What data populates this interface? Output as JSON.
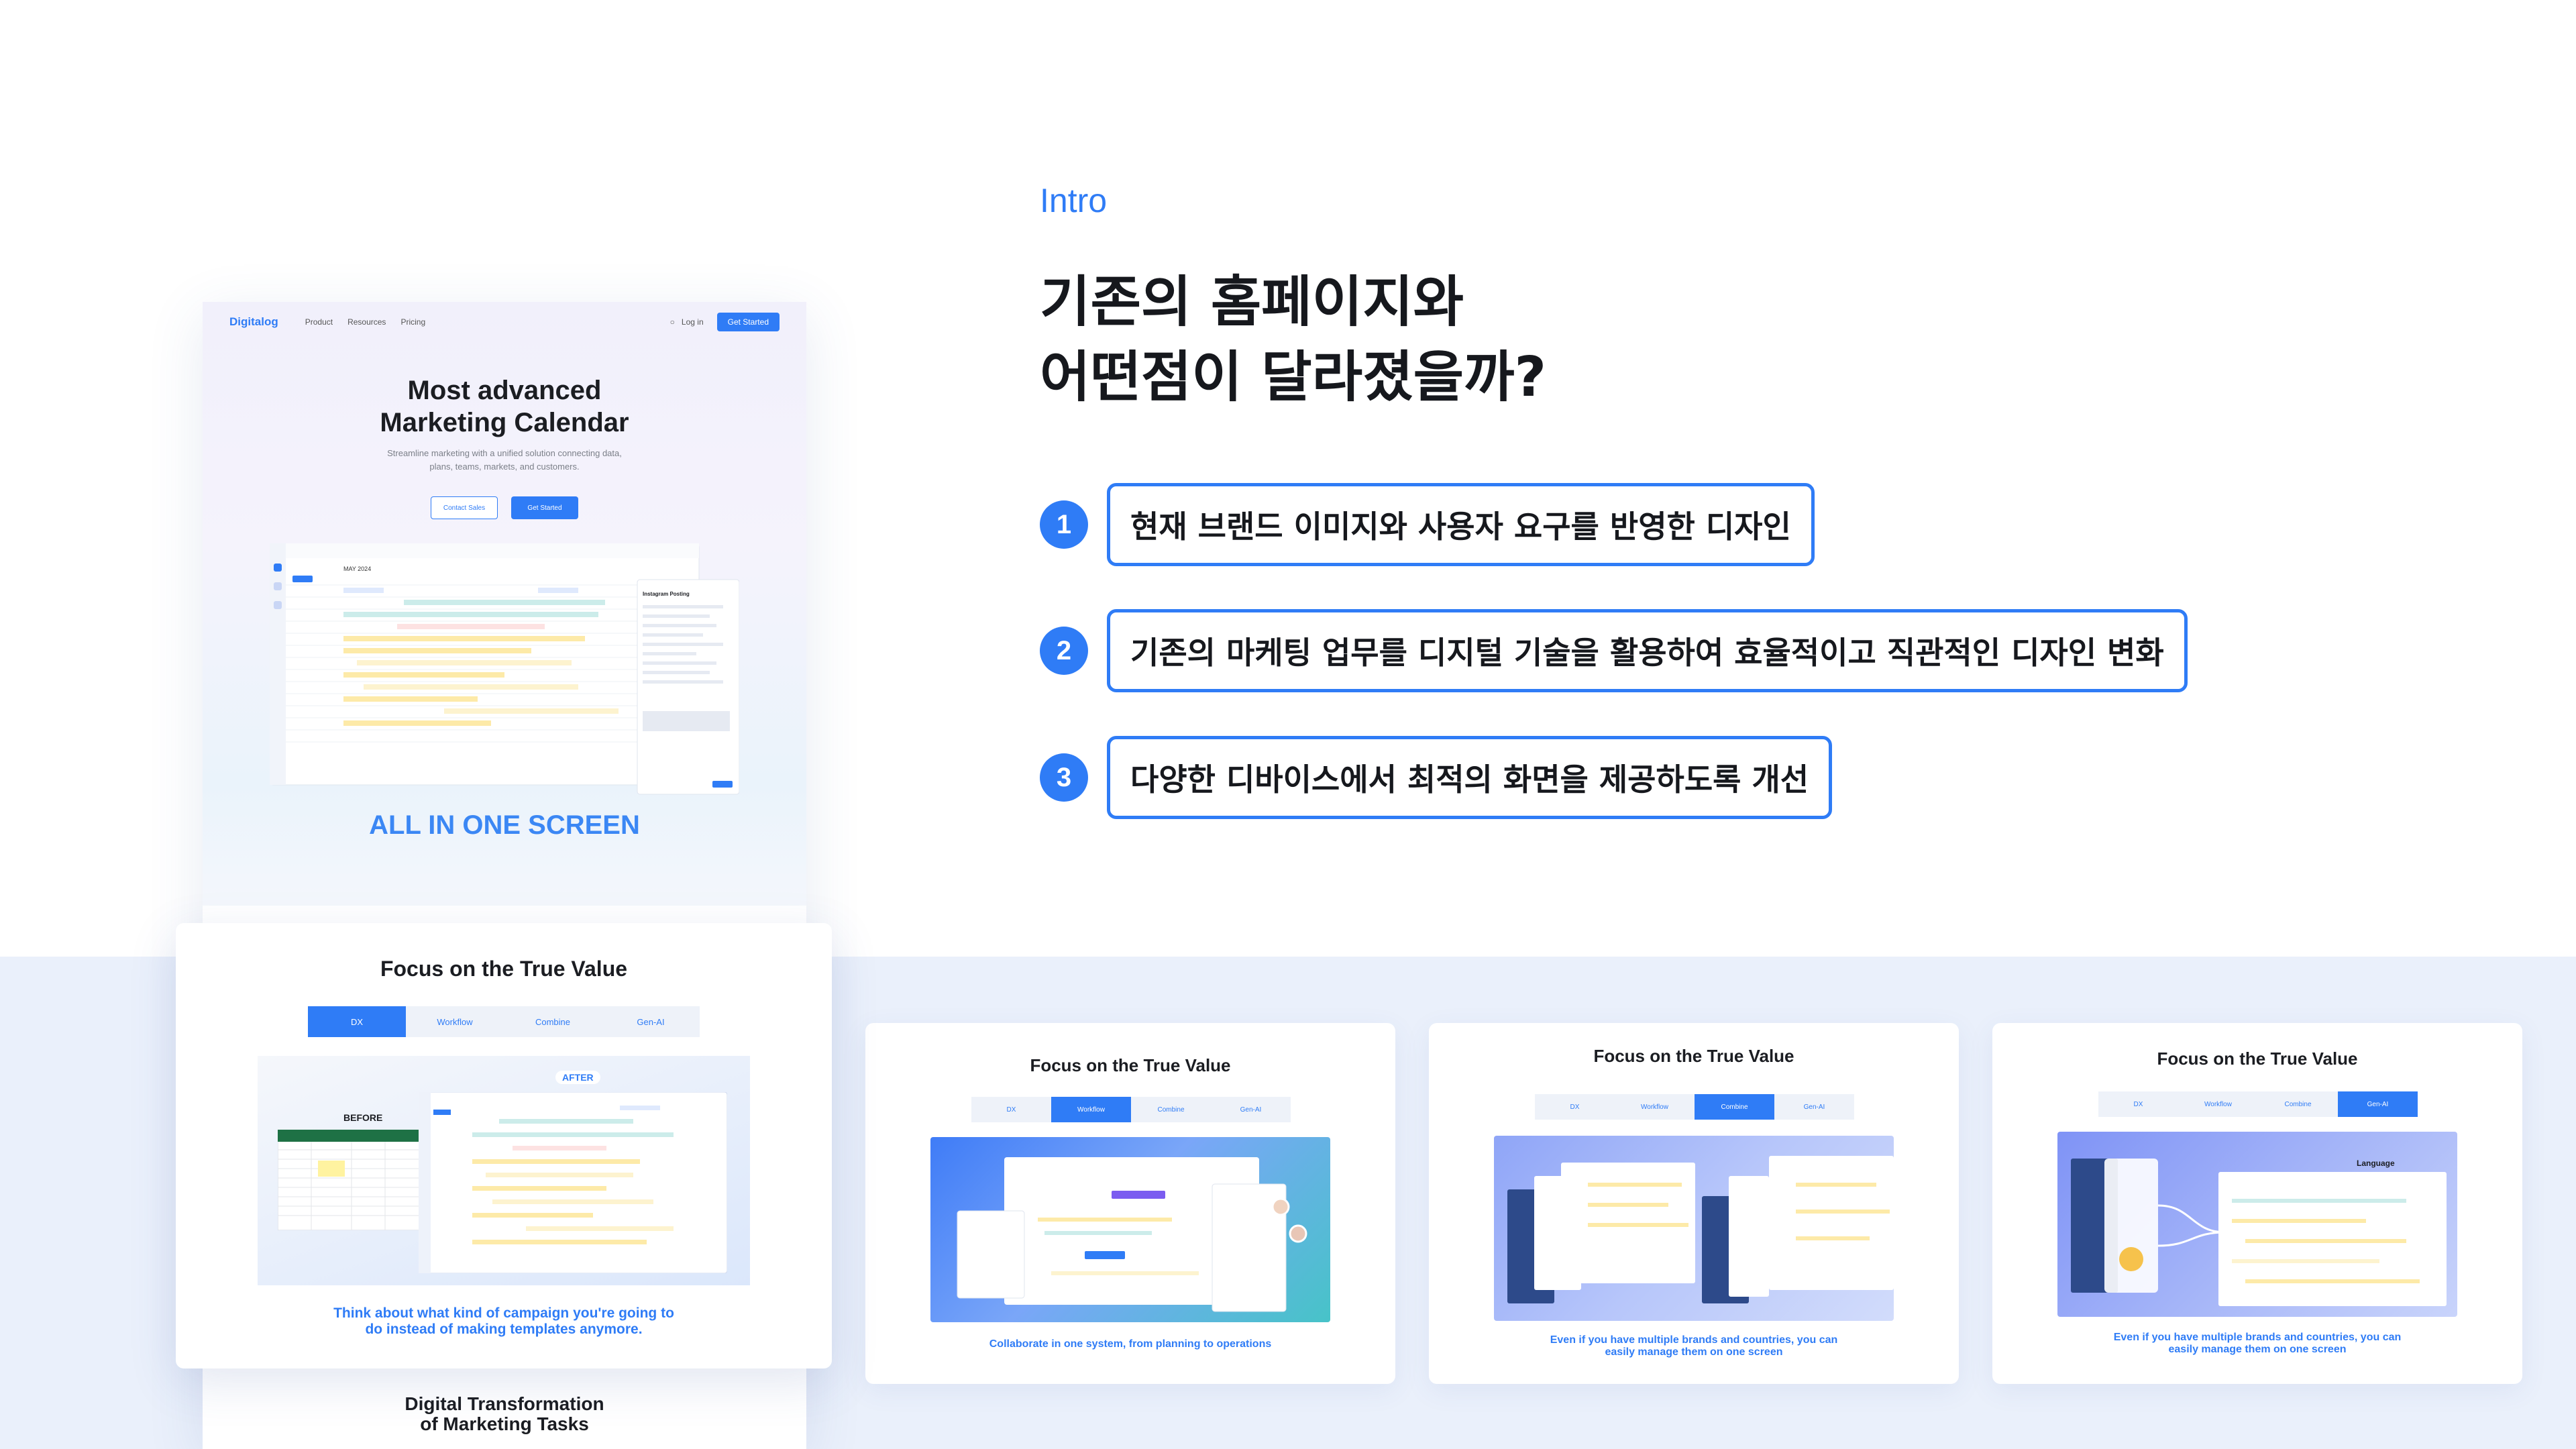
{
  "intro": {
    "label": "Intro",
    "title_line1": "기존의 홈페이지와",
    "title_line2": "어떤점이 달라졌을까?",
    "features": [
      {
        "num": "1",
        "text": "현재 브랜드 이미지와 사용자 요구를 반영한 디자인"
      },
      {
        "num": "2",
        "text": "기존의 마케팅 업무를 디지털 기술을 활용하여 효율적이고 직관적인 디자인 변화"
      },
      {
        "num": "3",
        "text": "다양한 디바이스에서 최적의 화면을 제공하도록 개선"
      }
    ]
  },
  "landing": {
    "logo": "Digitalog",
    "nav": [
      "Product",
      "Resources",
      "Pricing"
    ],
    "login": "Log in",
    "cta": "Get Started",
    "headline_1": "Most advanced",
    "headline_2": "Marketing Calendar",
    "sub_1": "Streamline marketing with a unified solution connecting data,",
    "sub_2": "plans, teams, markets, and customers.",
    "btn_contact": "Contact Sales",
    "btn_start": "Get Started",
    "app_month": "MAY 2024",
    "panel_title": "Instagram Posting",
    "all_in_one": "ALL IN ONE SCREEN",
    "bottom_title_1": "Digital Transformation",
    "bottom_title_2": "of Marketing Tasks"
  },
  "tabs": [
    "DX",
    "Workflow",
    "Combine",
    "Gen-AI"
  ],
  "cards": {
    "main": {
      "title": "Focus on the True Value",
      "before": "BEFORE",
      "after": "AFTER",
      "caption_1": "Think about what kind of campaign you're going to",
      "caption_2": "do instead of making templates anymore."
    },
    "workflow": {
      "title": "Focus on the True Value",
      "caption_1": "Collaborate in one system, from planning to operations"
    },
    "combine": {
      "title": "Focus on the True Value",
      "caption_1": "Even if you have multiple brands and countries, you can",
      "caption_2": "easily manage them on one screen"
    },
    "genai": {
      "title": "Focus on the True Value",
      "language": "Language",
      "caption_1": "Even if you have multiple brands and countries, you can",
      "caption_2": "easily manage them on one screen"
    }
  },
  "colors": {
    "accent": "#2f7cf6",
    "band": "#eaf0fb",
    "excel": "#1e7145"
  }
}
